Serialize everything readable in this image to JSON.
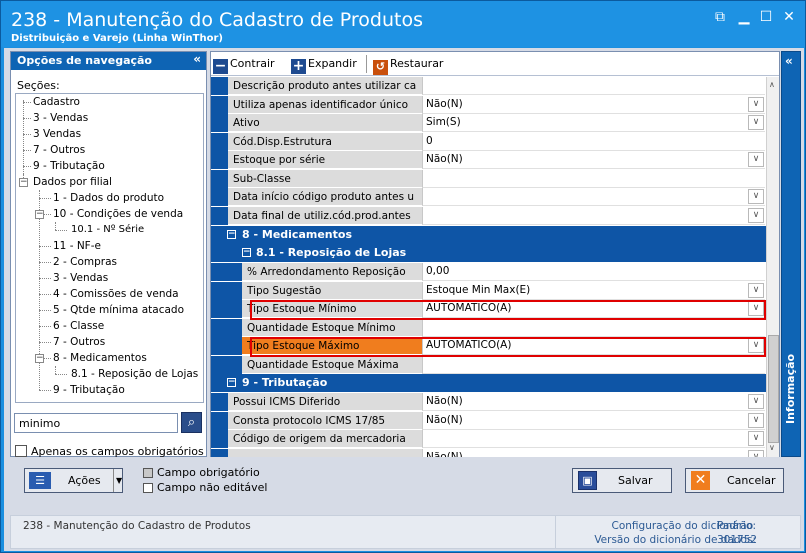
{
  "window": {
    "title": "238 - Manutenção do Cadastro de Produtos",
    "subtitle": "Distribuição e Varejo (Linha WinThor)"
  },
  "nav": {
    "header": "Opções de navegação",
    "sections_label": "Seções:",
    "items": [
      {
        "label": "Cadastro"
      },
      {
        "label": "3 - Vendas"
      },
      {
        "label": "3 Vendas"
      },
      {
        "label": "7 - Outros"
      },
      {
        "label": "9 - Tributação"
      },
      {
        "label": "Dados por filial"
      },
      {
        "label": "1 - Dados do produto"
      },
      {
        "label": "10 - Condições de venda"
      },
      {
        "label": "10.1 - Nº Série"
      },
      {
        "label": "11 - NF-e"
      },
      {
        "label": "2 - Compras"
      },
      {
        "label": "3 - Vendas"
      },
      {
        "label": "4 - Comissões de venda"
      },
      {
        "label": "5 - Qtde mínima atacado"
      },
      {
        "label": "6 - Classe"
      },
      {
        "label": "7 - Outros"
      },
      {
        "label": "8 - Medicamentos"
      },
      {
        "label": "8.1 -  Reposição de Lojas"
      },
      {
        "label": "9 - Tributação"
      }
    ],
    "search_value": "minimo",
    "required_only_label": "Apenas os campos obrigatórios"
  },
  "toolbar": {
    "collapse_label": "Contrair",
    "expand_label": "Expandir",
    "restore_label": "Restaurar"
  },
  "grid": {
    "rows_top": [
      {
        "label": "Descrição produto antes utilizar ca",
        "value": ""
      },
      {
        "label": "Utiliza apenas identificador único",
        "value": "Não(N)",
        "dropdown": true
      },
      {
        "label": "Ativo",
        "value": "Sim(S)",
        "dropdown": true
      },
      {
        "label": "Cód.Disp.Estrutura",
        "value": "0"
      },
      {
        "label": "Estoque por série",
        "value": "Não(N)",
        "dropdown": true
      },
      {
        "label": "Sub-Classe",
        "value": ""
      },
      {
        "label": "Data início código produto antes u",
        "value": "",
        "dropdown": true
      },
      {
        "label": "Data final de utiliz.cód.prod.antes",
        "value": "",
        "dropdown": true
      }
    ],
    "cat8": "8 - Medicamentos",
    "sub81": "8.1 -  Reposição de Lojas",
    "rows_81": [
      {
        "label": "% Arredondamento Reposição",
        "value": "0,00"
      },
      {
        "label": "Tipo Sugestão",
        "value": "Estoque Min Max(E)",
        "dropdown": true
      },
      {
        "label": "Tipo Estoque Mínimo",
        "value": "AUTOMATICO(A)",
        "dropdown": true
      },
      {
        "label": "Quantidade Estoque Mínimo",
        "value": ""
      },
      {
        "label": "Tipo Estoque Máximo",
        "value": "AUTOMATICO(A)",
        "dropdown": true
      },
      {
        "label": "Quantidade Estoque Máxima",
        "value": ""
      }
    ],
    "cat9": "9 - Tributação",
    "rows_9": [
      {
        "label": "Possui ICMS Diferido",
        "value": "Não(N)",
        "dropdown": true
      },
      {
        "label": "Consta protocolo ICMS 17/85",
        "value": "Não(N)",
        "dropdown": true
      },
      {
        "label": "Código de origem da mercadoria",
        "value": "",
        "dropdown": true
      },
      {
        "label": "",
        "value": "Não(N)",
        "dropdown": true
      }
    ]
  },
  "info_rail_label": "Informação",
  "bottom": {
    "actions_label": "Ações",
    "legend_required": "Campo obrigatório",
    "legend_readonly": "Campo não editável",
    "save_label": "Salvar",
    "cancel_label": "Cancelar"
  },
  "status": {
    "left": "238 - Manutenção do Cadastro de Produtos",
    "dict_config_label": "Configuração do dicionário:",
    "dict_config_value": "Padrão",
    "dict_version_label": "Versão do dicionário de dados:",
    "dict_version_value": "301752"
  },
  "colors": {
    "title_bg": "#1e92e3",
    "nav_header": "#0e64b4",
    "category_bg": "#0e55a6",
    "highlight_red": "#e00000",
    "selected_orange": "#f07d1e"
  }
}
